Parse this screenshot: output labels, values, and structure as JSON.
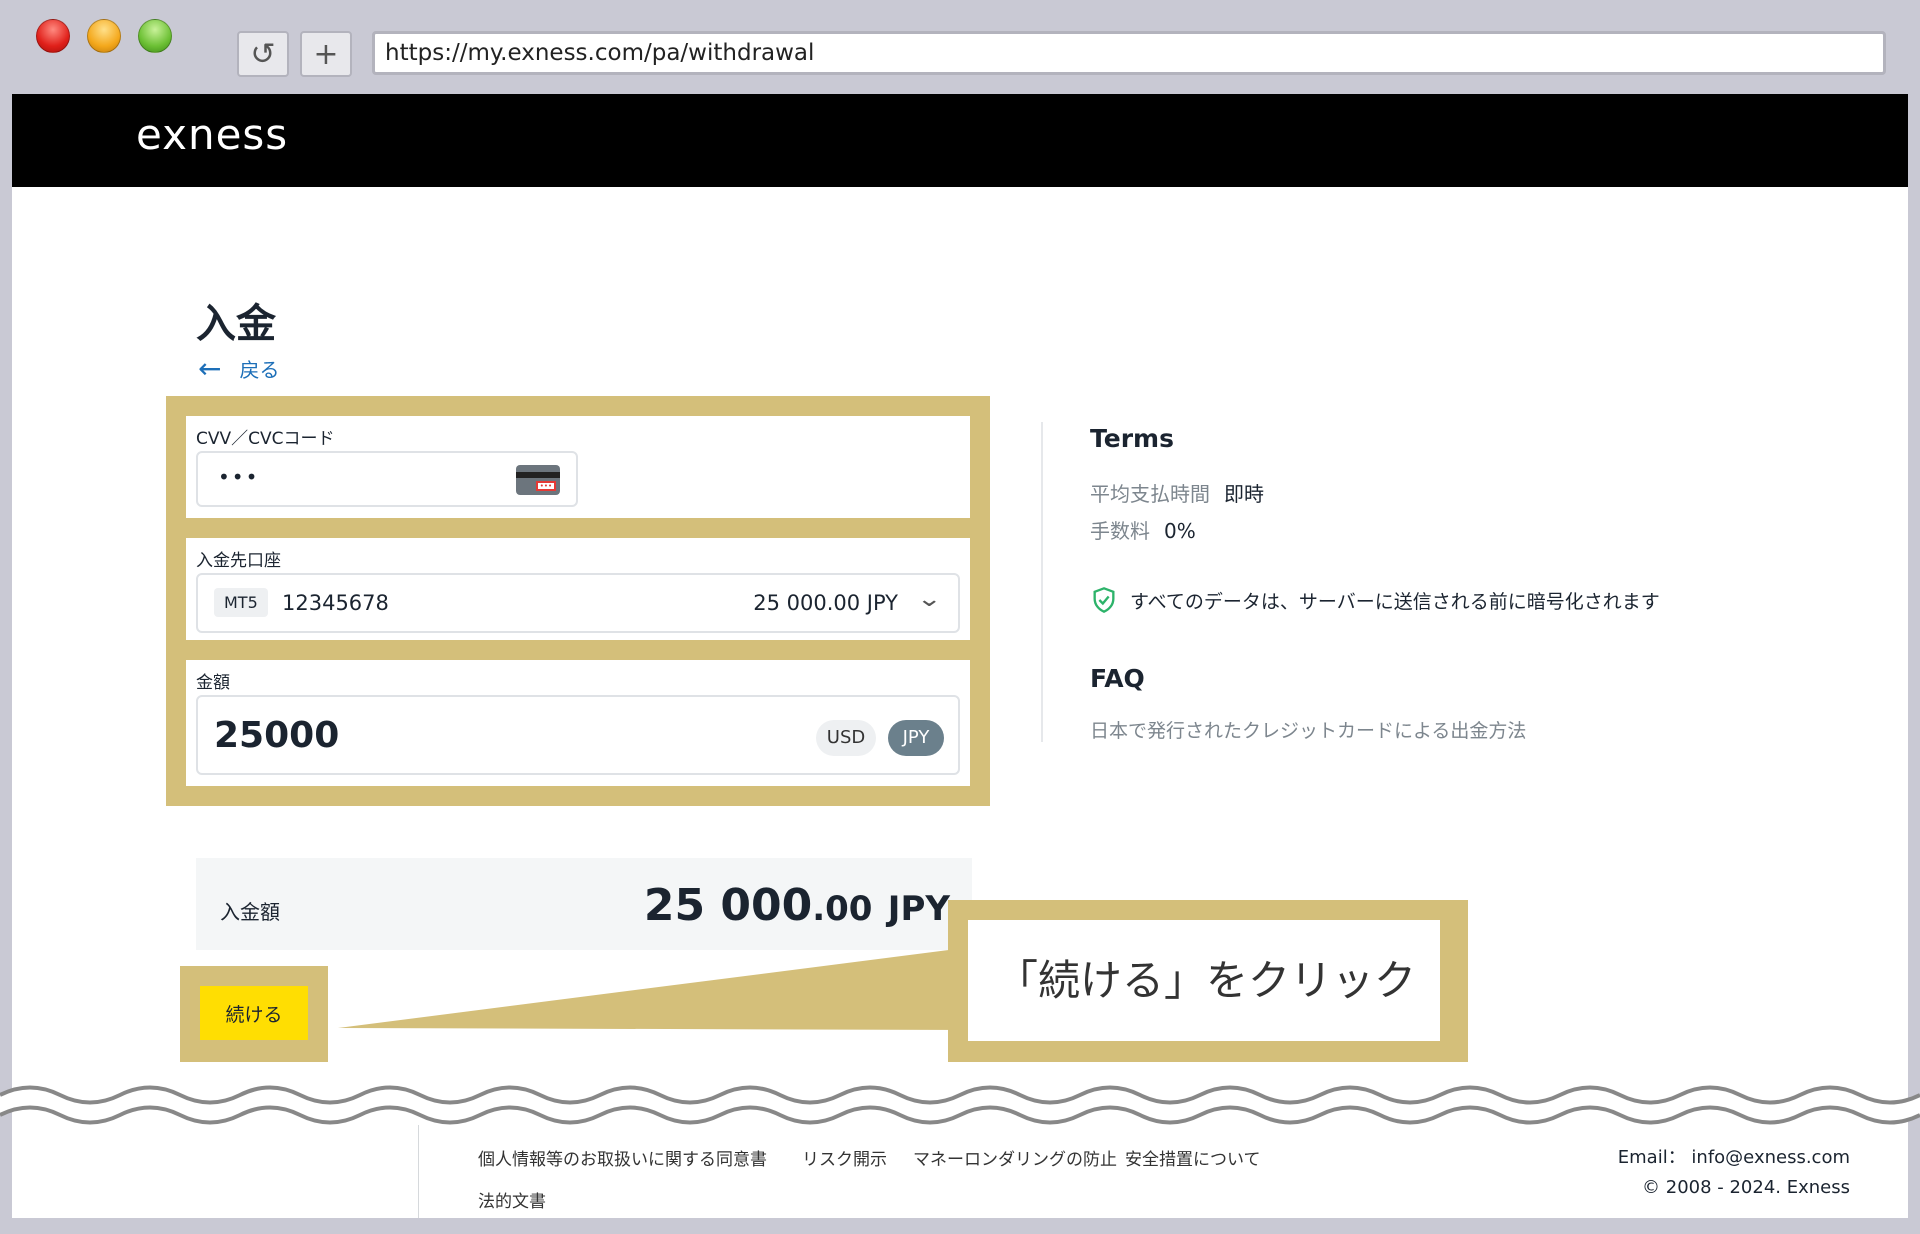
{
  "browser": {
    "url": "https://my.exness.com/pa/withdrawal"
  },
  "header": {
    "logo": "exness"
  },
  "page": {
    "title": "入金",
    "back_label": "戻る"
  },
  "form": {
    "cvv_label": "CVV／CVCコード",
    "cvv_value": "•••",
    "account_label": "入金先口座",
    "account_platform": "MT5",
    "account_number": "12345678",
    "account_balance": "25 000.00 JPY",
    "amount_label": "金額",
    "amount_value": "25000",
    "currency_usd": "USD",
    "currency_jpy": "JPY",
    "selected_currency": "JPY"
  },
  "summary": {
    "label": "入金額",
    "int": "25 000",
    "dec": ".00",
    "ccy": "JPY"
  },
  "continue_label": "続ける",
  "callout": "「続ける」をクリック",
  "terms": {
    "title": "Terms",
    "time_label": "平均支払時間",
    "time_value": "即時",
    "fee_label": "手数料",
    "fee_value": "0%",
    "secure_note": "すべてのデータは、サーバーに送信される前に暗号化されます",
    "faq_title": "FAQ",
    "faq_link": "日本で発行されたクレジットカードによる出金方法"
  },
  "footer": {
    "links": [
      "個人情報等のお取扱いに関する同意書",
      "リスク開示",
      "マネーロンダリングの防止",
      "安全措置について",
      "法的文書"
    ],
    "email": "Email： info@exness.com",
    "copyright": "© 2008 - 2024. Exness"
  },
  "colors": {
    "accent_yellow": "#ffde02",
    "highlight_gold": "#d4bf7a",
    "link_blue": "#1d6fb8",
    "secure_green": "#2db36a"
  }
}
